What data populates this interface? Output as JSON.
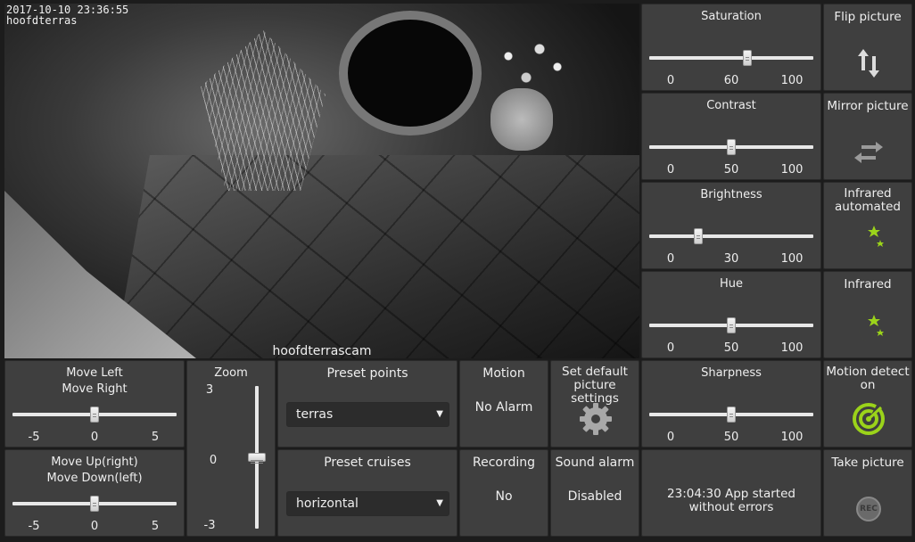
{
  "camera": {
    "timestamp": "2017-10-10 23:36:55",
    "osd_name": "hoofdterras",
    "caption": "hoofdterrascam"
  },
  "sliders": {
    "saturation": {
      "label": "Saturation",
      "min": "0",
      "value": "60",
      "max": "100",
      "level": 0.6
    },
    "contrast": {
      "label": "Contrast",
      "min": "0",
      "value": "50",
      "max": "100",
      "level": 0.5
    },
    "brightness": {
      "label": "Brightness",
      "min": "0",
      "value": "30",
      "max": "100",
      "level": 0.3
    },
    "hue": {
      "label": "Hue",
      "min": "0",
      "value": "50",
      "max": "100",
      "level": 0.5
    },
    "sharpness": {
      "label": "Sharpness",
      "min": "0",
      "value": "50",
      "max": "100",
      "level": 0.5
    },
    "move_lr": {
      "label_line1": "Move Left",
      "label_line2": "Move Right",
      "min": "-5",
      "value": "0",
      "max": "5",
      "level": 0.5
    },
    "move_ud": {
      "label_line1": "Move Up(right)",
      "label_line2": "Move Down(left)",
      "min": "-5",
      "value": "0",
      "max": "5",
      "level": 0.5
    },
    "zoom": {
      "label": "Zoom",
      "max": "3",
      "value": "0",
      "min": "-3",
      "level": 0.5
    }
  },
  "buttons": {
    "flip": {
      "label": "Flip picture",
      "icon": "flip-vertical-arrows-icon"
    },
    "mirror": {
      "label": "Mirror picture",
      "icon": "mirror-horizontal-arrows-icon"
    },
    "infrared_auto": {
      "label_line1": "Infrared",
      "label_line2": "automated",
      "icon": "moon-stars-icon"
    },
    "infrared": {
      "label": "Infrared",
      "icon": "moon-stars-icon"
    },
    "motion_detect": {
      "label_line1": "Motion detect",
      "label_line2": "on",
      "icon": "radar-target-icon"
    },
    "take_picture": {
      "label": "Take picture",
      "icon": "rec-icon",
      "icon_text": "REC"
    },
    "defaults": {
      "label_line1": "Set default",
      "label_line2": "picture settings",
      "icon": "gear-icon"
    }
  },
  "presets": {
    "points": {
      "label": "Preset points",
      "selected": "terras"
    },
    "cruises": {
      "label": "Preset cruises",
      "selected": "horizontal"
    }
  },
  "status": {
    "motion": {
      "label": "Motion",
      "value": "No Alarm"
    },
    "recording": {
      "label": "Recording",
      "value": "No"
    },
    "sound_alarm": {
      "label": "Sound alarm",
      "value": "Disabled"
    },
    "log": "23:04:30 App started without errors"
  },
  "colors": {
    "accent_green": "#9bd31a",
    "panel_bg": "#3f3f3f",
    "page_bg": "#1c1c1c"
  }
}
